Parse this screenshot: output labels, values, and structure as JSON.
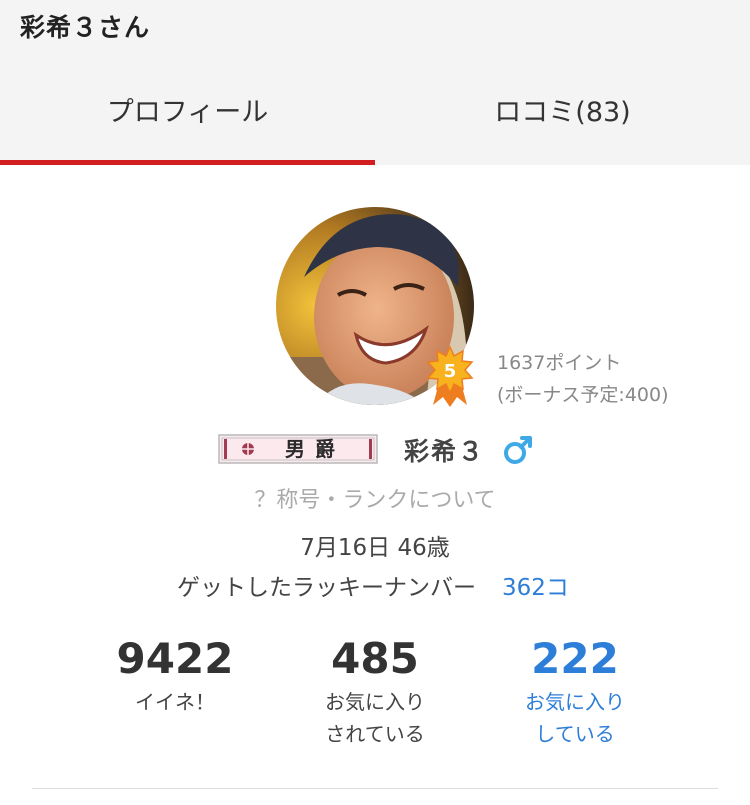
{
  "page_title": "彩希３さん",
  "tabs": [
    {
      "label": "プロフィール",
      "active": true
    },
    {
      "label": "ロコミ(83)",
      "active": false
    }
  ],
  "colors": {
    "accent_red": "#d11f1f",
    "link_blue": "#2d7ed8",
    "header_bg": "#f4f4f4"
  },
  "profile": {
    "rank_level": "5",
    "points": "1637ポイント",
    "bonus": "(ボーナス予定:400)",
    "title_badge": "男爵",
    "name": "彩希３",
    "gender_icon": "male-symbol-icon",
    "title_rank_link": "？称号・ランクについて",
    "birthday_age": "7月16日 46歳",
    "lucky_label": "ゲットしたラッキーナンバー",
    "lucky_value": "362コ"
  },
  "stats": [
    {
      "value": "9422",
      "label_line1": "イイネ！",
      "label_line2": ""
    },
    {
      "value": "485",
      "label_line1": "お気に入り",
      "label_line2": "されている"
    },
    {
      "value": "222",
      "label_line1": "お気に入り",
      "label_line2": "している"
    }
  ]
}
